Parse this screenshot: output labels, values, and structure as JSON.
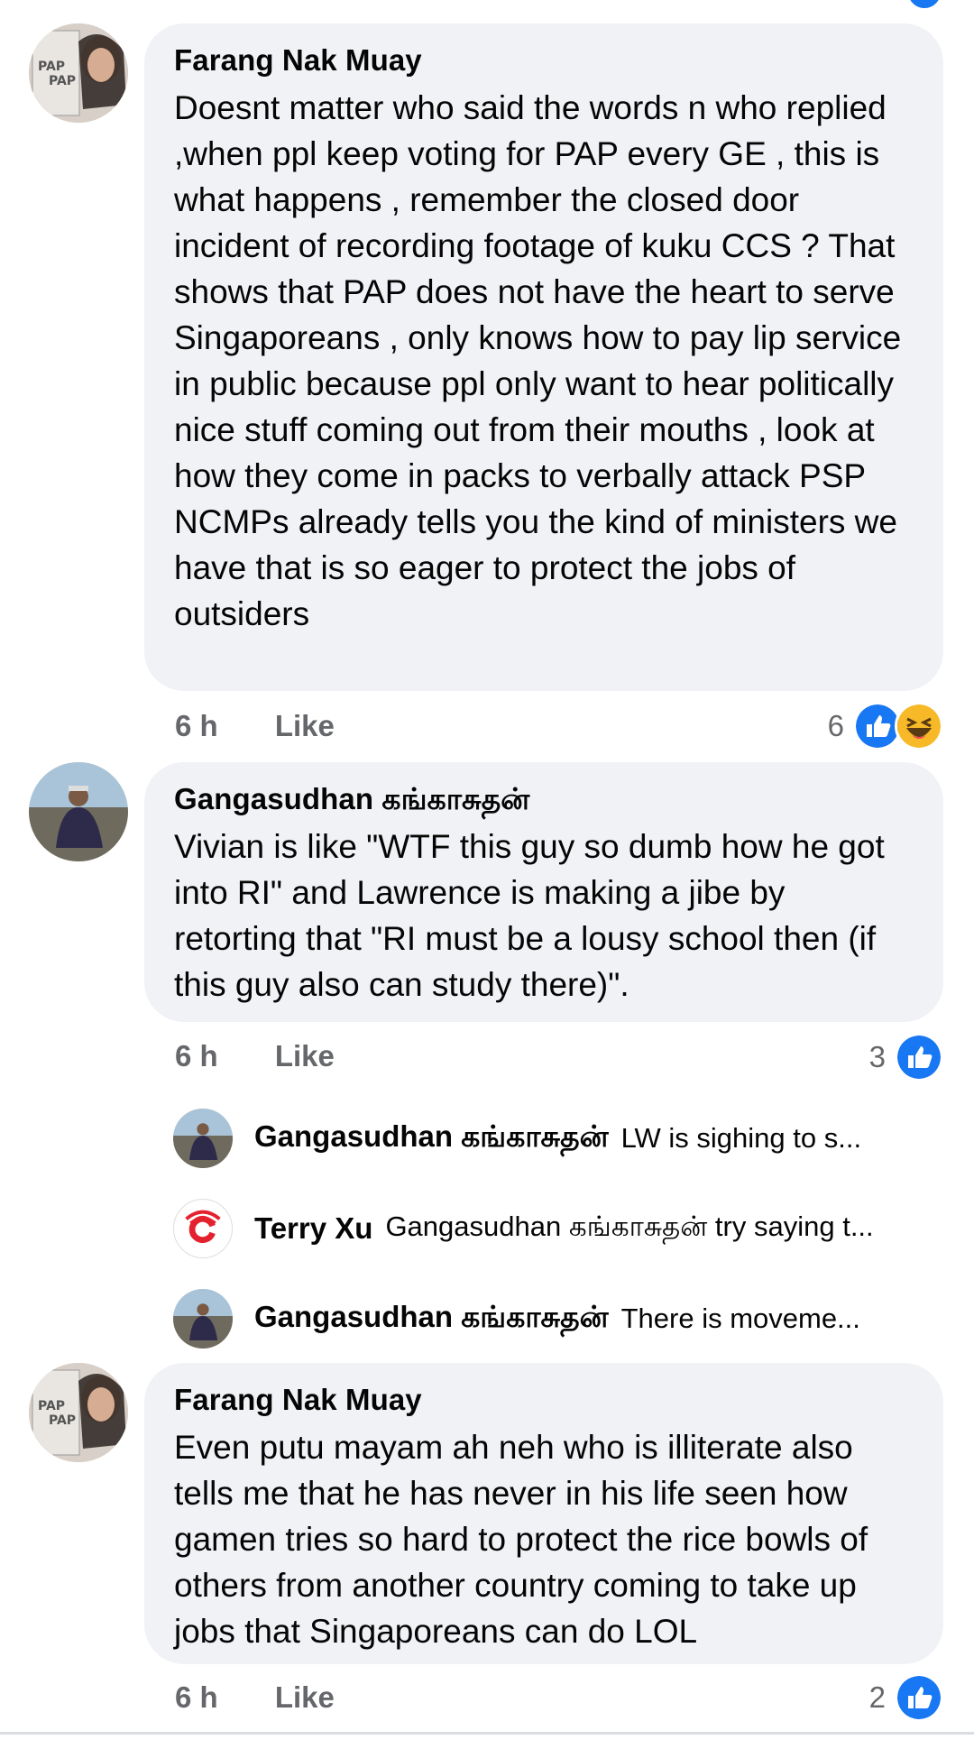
{
  "comments": [
    {
      "author": "Farang Nak Muay",
      "text": "Doesnt matter who said the words n who replied ,when ppl keep voting for PAP every GE , this is what happens , remember the closed door incident of recording footage of kuku CCS ? That shows that PAP does not have the heart to serve Singaporeans , only knows how to pay lip service in public because ppl only want to hear politically nice stuff coming out from their mouths , look at how they come in packs to verbally attack PSP NCMPs already tells you the kind of ministers we have that is so eager to protect the jobs of outsiders",
      "time": "6 h",
      "like_label": "Like",
      "reaction_count": "6",
      "reactions": [
        "like",
        "haha"
      ]
    },
    {
      "author": "Gangasudhan கங்காசுதன்",
      "text": "Vivian is like \"WTF this guy so dumb how he got into RI\" and Lawrence is making a jibe by retorting that \"RI must be a lousy school then (if this guy also can study there)\".",
      "time": "6 h",
      "like_label": "Like",
      "reaction_count": "3",
      "reactions": [
        "like"
      ]
    },
    {
      "author": "Farang Nak Muay",
      "text": "Even putu mayam ah neh who is illiterate also tells me that he has never in his life seen how gamen tries so hard to protect the rice bowls of others from another country coming to take up jobs that Singaporeans can do LOL",
      "time": "6 h",
      "like_label": "Like",
      "reaction_count": "2",
      "reactions": [
        "like"
      ]
    }
  ],
  "replies": [
    {
      "author": "Gangasudhan கங்காசுதன்",
      "preview": "LW is sighing to s..."
    },
    {
      "author": "Terry Xu",
      "preview": "Gangasudhan கங்காசுதன் try saying t..."
    },
    {
      "author": "Gangasudhan கங்காசுதன்",
      "preview": "There is moveme..."
    }
  ],
  "colors": {
    "bubble": "#f0f2f5",
    "meta_text": "#65676b",
    "like_blue": "#1877f2",
    "haha_yellow": "#f7b928",
    "terry_red": "#e4212f"
  }
}
